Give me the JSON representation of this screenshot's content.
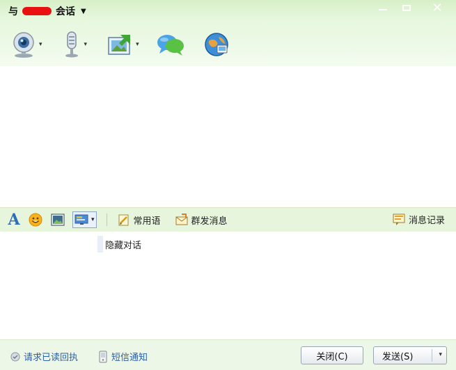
{
  "window": {
    "title_prefix": "与",
    "title_suffix": "会话",
    "title_caret": "▼",
    "close_glyph": "✕"
  },
  "toolbar": {
    "items": [
      {
        "name": "webcam-icon",
        "has_dropdown": true
      },
      {
        "name": "microphone-icon",
        "has_dropdown": true
      },
      {
        "name": "send-file-icon",
        "has_dropdown": true
      },
      {
        "name": "chat-bubbles-icon",
        "has_dropdown": false
      },
      {
        "name": "globe-app-icon",
        "has_dropdown": false
      }
    ],
    "dropdown_glyph": "▾"
  },
  "midbar": {
    "font_glyph": "A",
    "common_phrases": "常用语",
    "group_message": "群发消息",
    "message_history": "消息记录",
    "dropdown_glyph": "▾"
  },
  "input": {
    "hidden_chat_text": "隐藏对话"
  },
  "bottom": {
    "read_receipt": "请求已读回执",
    "sms_notify": "短信通知",
    "close_button": "关闭(C)",
    "send_button": "发送(S)",
    "send_dropdown_glyph": "▾"
  },
  "colors": {
    "header_green": "#d7f0c8",
    "midbar_green": "#e6f5dc",
    "link_blue": "#2a5fa8",
    "font_blue": "#2e6db8"
  }
}
